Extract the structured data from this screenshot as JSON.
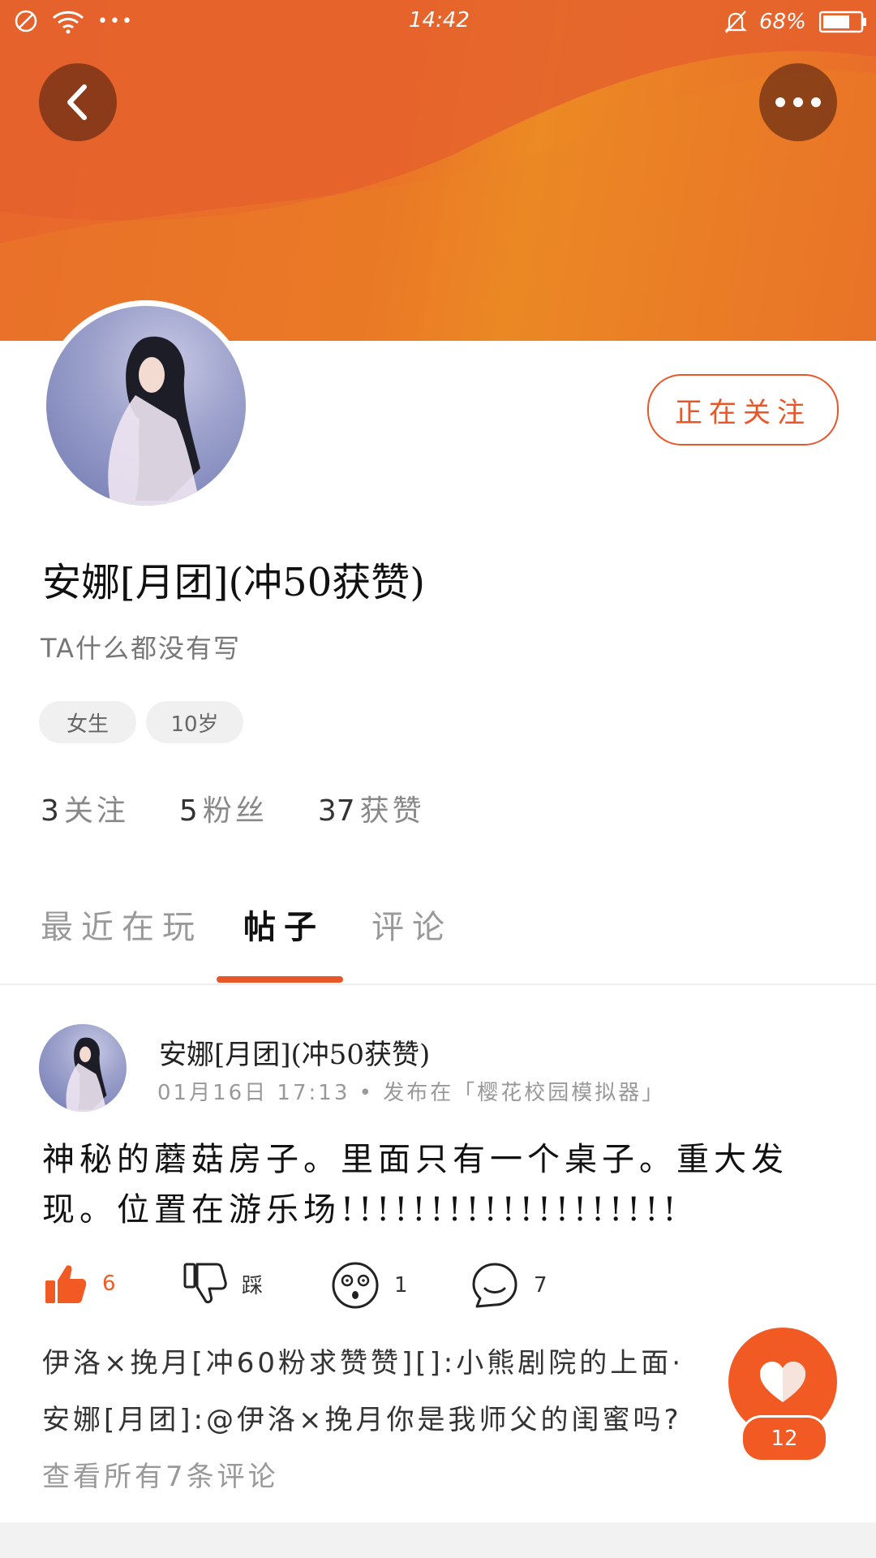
{
  "status_bar": {
    "time": "14:42",
    "battery": "68%",
    "more_dots": "•••"
  },
  "profile": {
    "name": "安娜[月团](冲50获赞)",
    "bio": "TA什么都没有写",
    "follow_button": "正在关注",
    "tags": [
      "女生",
      "10岁"
    ],
    "stats": [
      {
        "value": "3",
        "label": "关注"
      },
      {
        "value": "5",
        "label": "粉丝"
      },
      {
        "value": "37",
        "label": "获赞"
      }
    ]
  },
  "tabs": [
    {
      "label": "最近在玩",
      "active": false
    },
    {
      "label": "帖子",
      "active": true
    },
    {
      "label": "评论",
      "active": false
    }
  ],
  "post": {
    "author": "安娜[月团](冲50获赞)",
    "meta": "01月16日 17:13 • 发布在「樱花校园模拟器」",
    "body": "神秘的蘑菇房子。里面只有一个桌子。重大发现。位置在游乐场!!!!!!!!!!!!!!!!!!!",
    "actions": {
      "like_count": "6",
      "dislike_label": "踩",
      "surprise_count": "1",
      "comment_count": "7"
    },
    "comments": [
      "伊洛×挽月[冲60粉求赞赞][]:小熊剧院的上面·",
      "安娜[月团]:@伊洛×挽月你是我师父的闺蜜吗?"
    ],
    "view_all": "查看所有7条评论"
  },
  "fab": {
    "count": "12"
  },
  "colors": {
    "accent": "#e8572a",
    "header": "#ea7427"
  }
}
